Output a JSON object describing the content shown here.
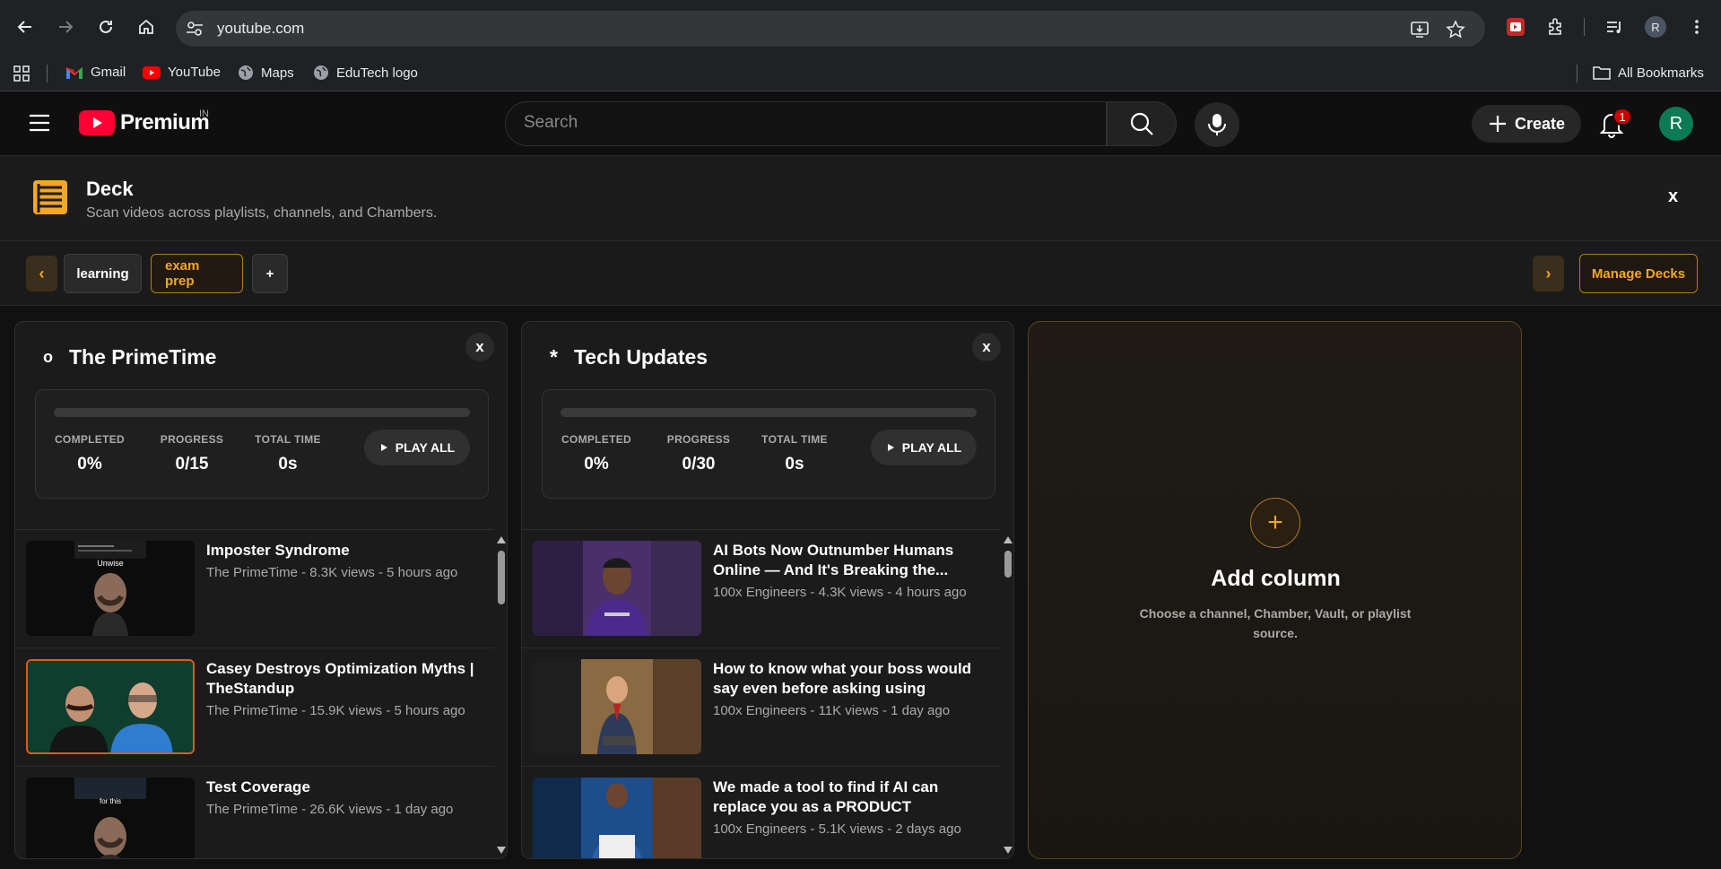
{
  "browser": {
    "url": "youtube.com",
    "bookmarks": [
      "Gmail",
      "YouTube",
      "Maps",
      "EduTech logo"
    ],
    "all_bookmarks": "All Bookmarks",
    "profile_initial": "R"
  },
  "header": {
    "logo_text": "Premium",
    "country_code": "IN",
    "search_placeholder": "Search",
    "create_label": "Create",
    "notification_count": "1",
    "avatar_initial": "R"
  },
  "deck": {
    "title": "Deck",
    "subtitle": "Scan videos across playlists, channels, and Chambers.",
    "close_label": "x",
    "prev_label": "‹",
    "next_label": "›",
    "tabs": [
      {
        "label": "learning",
        "active": false
      },
      {
        "label": "exam prep",
        "active": true
      },
      {
        "label": "+",
        "active": false
      }
    ],
    "manage_label": "Manage Decks"
  },
  "columns": [
    {
      "marker": "o",
      "title": "The PrimeTime",
      "close_label": "x",
      "progress_fraction": 0,
      "stats": {
        "completed_label": "COMPLETED",
        "completed": "0%",
        "progress_label": "PROGRESS",
        "progress": "0/15",
        "time_label": "TOTAL TIME",
        "time": "0s"
      },
      "play_all": "PLAY ALL",
      "videos": [
        {
          "title": "Imposter Syndrome",
          "meta": "The PrimeTime - 8.3K views - 5 hours ago"
        },
        {
          "title": "Casey Destroys Optimization Myths | TheStandup",
          "meta": "The PrimeTime - 15.9K views - 5 hours ago"
        },
        {
          "title": "Test Coverage",
          "meta": "The PrimeTime - 26.6K views - 1 day ago"
        }
      ]
    },
    {
      "marker": "*",
      "title": "Tech Updates",
      "close_label": "x",
      "progress_fraction": 0,
      "stats": {
        "completed_label": "COMPLETED",
        "completed": "0%",
        "progress_label": "PROGRESS",
        "progress": "0/30",
        "time_label": "TOTAL TIME",
        "time": "0s"
      },
      "play_all": "PLAY ALL",
      "videos": [
        {
          "title": "AI Bots Now Outnumber Humans Online — And It's Breaking the...",
          "meta": "100x Engineers - 4.3K views - 4 hours ago"
        },
        {
          "title": "How to know what your boss would say even before asking using Claude...",
          "meta": "100x Engineers - 11K views - 1 day ago"
        },
        {
          "title": "We made a tool to find if AI can replace you as a PRODUCT MANAGER",
          "meta": "100x Engineers - 5.1K views - 2 days ago"
        }
      ]
    }
  ],
  "add_column": {
    "plus": "+",
    "title": "Add column",
    "subtitle": "Choose a channel, Chamber, Vault, or playlist source."
  },
  "thumb_captions": {
    "first": "Unwise",
    "third": "for this"
  },
  "colors": {
    "accent": "#f5a623",
    "yt_red": "#ff0033",
    "avatar": "#0b7a55"
  }
}
